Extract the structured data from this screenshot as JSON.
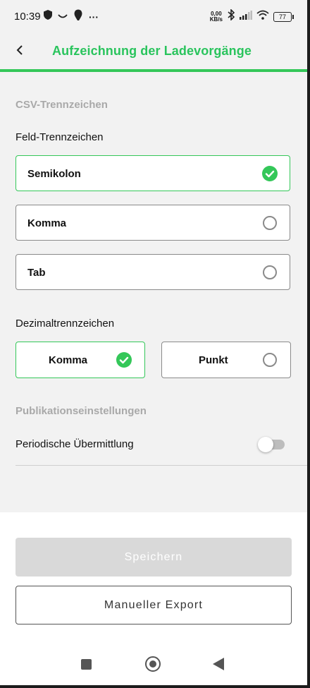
{
  "status_bar": {
    "time": "10:39",
    "speed_value": "0,00",
    "speed_unit": "KB/s",
    "battery": "77",
    "more_dots": "···"
  },
  "header": {
    "title": "Aufzeichnung der Ladevorgänge",
    "accent_color": "#34c759"
  },
  "csv": {
    "section_title": "CSV-Trennzeichen",
    "field_separator_label": "Feld-Trennzeichen",
    "field_options": [
      {
        "label": "Semikolon",
        "selected": true
      },
      {
        "label": "Komma",
        "selected": false
      },
      {
        "label": "Tab",
        "selected": false
      }
    ],
    "decimal_separator_label": "Dezimaltrennzeichen",
    "decimal_options": [
      {
        "label": "Komma",
        "selected": true
      },
      {
        "label": "Punkt",
        "selected": false
      }
    ]
  },
  "publication": {
    "section_title": "Publikationseinstellungen",
    "periodic_label": "Periodische Übermittlung",
    "periodic_enabled": false
  },
  "actions": {
    "save_label": "Speichern",
    "export_label": "Manueller Export"
  }
}
